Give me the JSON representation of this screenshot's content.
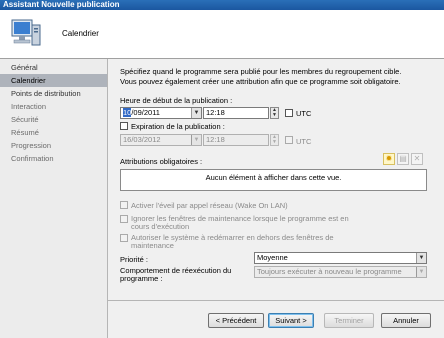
{
  "window": {
    "title": "Assistant Nouvelle publication"
  },
  "header": {
    "title": "Calendrier",
    "icon": "computer-icon"
  },
  "sidebar": {
    "items": [
      {
        "label": "Général"
      },
      {
        "label": "Calendrier",
        "active": true
      },
      {
        "label": "Points de distribution"
      },
      {
        "label": "Interaction"
      },
      {
        "label": "Sécurité"
      },
      {
        "label": "Résumé"
      },
      {
        "label": "Progression"
      },
      {
        "label": "Confirmation"
      }
    ]
  },
  "main": {
    "description": "Spécifiez quand le programme sera publié pour les membres du regroupement cible. Vous pouvez également créer une attribution afin que ce programme soit obligatoire.",
    "start": {
      "label": "Heure de début de la publication :",
      "date_hl": "10",
      "date_rest": "/09/2011",
      "time": "12:18",
      "utc_label": "UTC"
    },
    "expiration": {
      "label": "Expiration de la publication :",
      "date": "16/03/2012",
      "time": "12:18",
      "utc_label": "UTC"
    },
    "assignments": {
      "label": "Attributions obligatoires :",
      "empty_text": "Aucun élément à afficher dans cette vue."
    },
    "options": {
      "wake_on_lan": "Activer l'éveil par appel réseau (Wake On LAN)",
      "ignore_maintenance_1": "Ignorer les fenêtres de maintenance lorsque le programme est en",
      "ignore_maintenance_2": "cours d'exécution",
      "allow_restart_1": "Autoriser le système à redémarrer en dehors des fenêtres de",
      "allow_restart_2": "maintenance"
    },
    "priority": {
      "label": "Priorité :",
      "value": "Moyenne"
    },
    "rerun": {
      "label_1": "Comportement de réexécution du",
      "label_2": "programme :",
      "value": "Toujours exécuter à nouveau le programme"
    }
  },
  "footer": {
    "prev": "< Précédent",
    "next": "Suivant >",
    "finish": "Terminer",
    "cancel": "Annuler"
  },
  "colors": {
    "title_bar": "#1b57a0",
    "selection": "#3169c6",
    "active_nav": "#aeb3bb"
  }
}
